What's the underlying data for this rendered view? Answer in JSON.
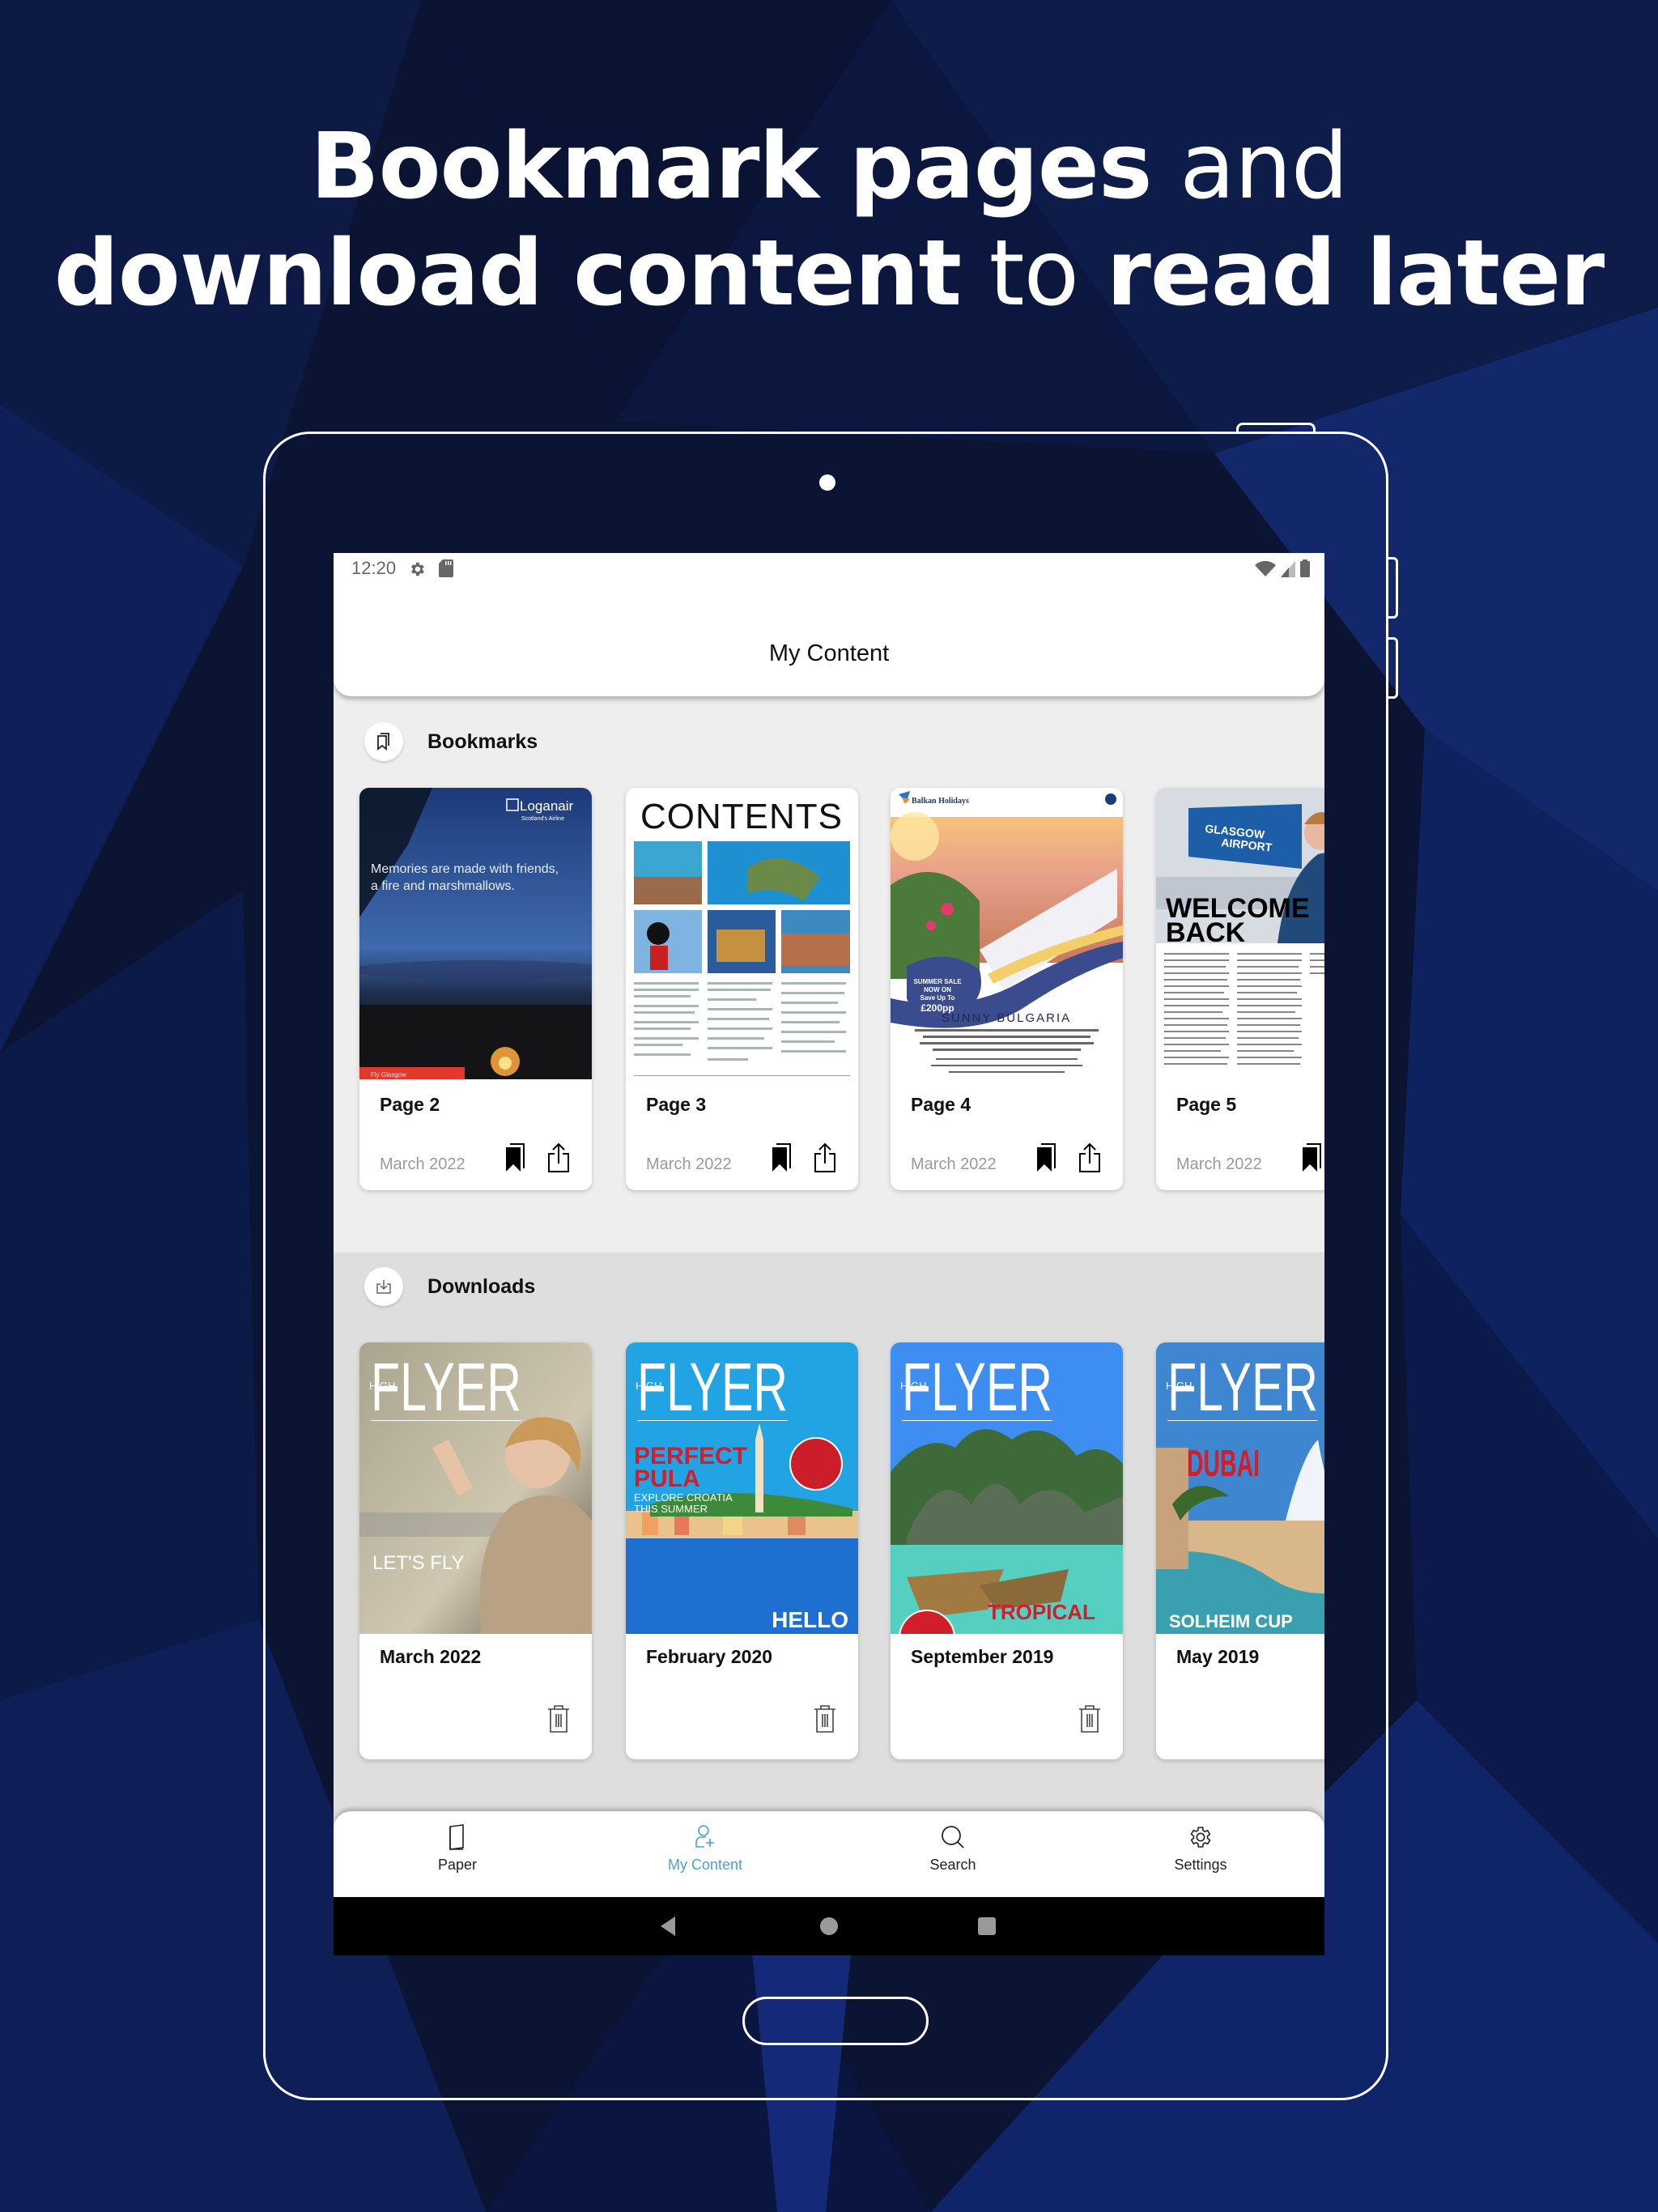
{
  "headline": {
    "line1_bold": "Bookmark pages",
    "line1_normal": " and",
    "line2_bold_a": "download content",
    "line2_normal": " to ",
    "line2_bold_b": "read later"
  },
  "status_bar": {
    "time": "12:20",
    "left_icons": [
      "gear-icon",
      "sd-card-icon"
    ],
    "right_icons": [
      "wifi-icon",
      "cell-signal-icon",
      "battery-icon"
    ]
  },
  "app": {
    "title": "My Content",
    "accent_color": "#4a9fd8"
  },
  "bookmarks": {
    "label": "Bookmarks",
    "icon": "bookmarks-icon",
    "items": [
      {
        "title": "Page 2",
        "date": "March 2022",
        "thumb": "Loganair ad - Memories are made with friends, a fire and marshmallows."
      },
      {
        "title": "Page 3",
        "date": "March 2022",
        "thumb": "CONTENTS"
      },
      {
        "title": "Page 4",
        "date": "March 2022",
        "thumb": "Balkan Holidays - SUNNY BULGARIA"
      },
      {
        "title": "Page 5",
        "date": "March 2022",
        "thumb": "WELCOME BACK - Glasgow Airport"
      }
    ]
  },
  "downloads": {
    "label": "Downloads",
    "icon": "download-icon",
    "items": [
      {
        "title": "March 2022",
        "thumb": "HIGH FLYER - LET'S FLY"
      },
      {
        "title": "February 2020",
        "thumb": "HIGH FLYER - PERFECT PULA"
      },
      {
        "title": "September 2019",
        "thumb": "HIGH FLYER - TROPICAL PARADISE"
      },
      {
        "title": "May 2019",
        "thumb": "HIGH FLYER - DUBAI"
      }
    ]
  },
  "thumb_text": {
    "loganair_brand": "Loganair",
    "loganair_tag": "Scotland's Airline",
    "loganair_line1": "Memories are made with friends,",
    "loganair_line2": "a fire and marshmallows.",
    "loganair_footer": "Fly Glasgow",
    "contents": "CONTENTS",
    "balkan_brand": "Balkan Holidays",
    "balkan_sale1": "SUMMER SALE",
    "balkan_sale2": "NOW ON",
    "balkan_sale3": "Save Up To",
    "balkan_sale4": "£200pp",
    "balkan_title": "SUNNY BULGARIA",
    "welcome1": "WELCOME",
    "welcome2": "BACK",
    "flyer": "FLYER",
    "high": "HIGH",
    "letsfly": "LET'S FLY",
    "perfect": "PERFECT",
    "pula": "PULA",
    "croatia1": "EXPLORE CROATIA",
    "croatia2": "THIS SUMMER",
    "hello": "HELLO",
    "tropical": "TROPICAL",
    "dubai": "DUBAI",
    "solheim": "SOLHEIM CUP"
  },
  "bottom_nav": {
    "items": [
      {
        "label": "Paper",
        "icon": "paper-icon",
        "active": false
      },
      {
        "label": "My Content",
        "icon": "add-user-icon",
        "active": true
      },
      {
        "label": "Search",
        "icon": "search-icon",
        "active": false
      },
      {
        "label": "Settings",
        "icon": "gear-icon",
        "active": false
      }
    ]
  },
  "system_nav": {
    "buttons": [
      "back",
      "home",
      "recents"
    ]
  }
}
